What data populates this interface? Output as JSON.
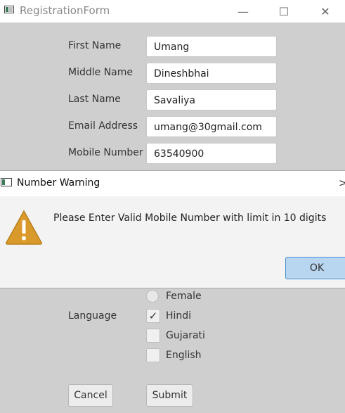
{
  "window": {
    "title": "RegistrationForm",
    "minimize_glyph": "—",
    "maximize_glyph": "☐",
    "close_glyph": "✕"
  },
  "form": {
    "fields": [
      {
        "label": "First Name",
        "value": "Umang"
      },
      {
        "label": "Middle Name",
        "value": "Dineshbhai"
      },
      {
        "label": "Last Name",
        "value": "Savaliya"
      },
      {
        "label": "Email Address",
        "value": "umang@30gmail.com"
      },
      {
        "label": "Mobile Number",
        "value": "63540900"
      }
    ],
    "gender": {
      "visible_option": "Female",
      "selected": false
    },
    "language": {
      "label": "Language",
      "options": [
        {
          "label": "Hindi",
          "checked": true,
          "mark": "✓"
        },
        {
          "label": "Gujarati",
          "checked": false
        },
        {
          "label": "English",
          "checked": false
        }
      ]
    },
    "buttons": {
      "cancel": "Cancel",
      "submit": "Submit"
    }
  },
  "dialog": {
    "title": "Number Warning",
    "close_glyph": ">",
    "icon": "warning-icon",
    "message": "Please Enter Valid Mobile Number with limit in 10 digits",
    "ok_label": "OK"
  },
  "colors": {
    "warning_fill": "#d99a2b",
    "ok_button": "#b9d6f1",
    "ok_border": "#4b8fd1"
  }
}
